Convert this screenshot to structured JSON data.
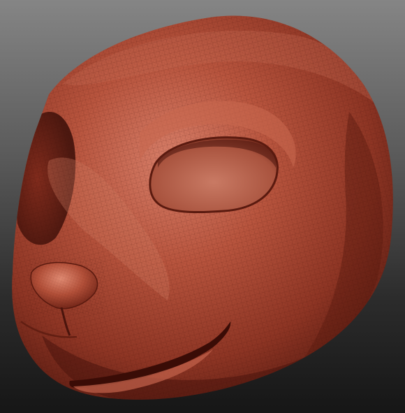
{
  "scene": {
    "subject": "rabbit-head-sculpt",
    "render_mode": "wireframe-polyframe",
    "colors": {
      "background_top": "#858585",
      "background_bottom": "#161616",
      "clay_highlight": "#d9806a",
      "clay_base": "#a8442f",
      "clay_shadow": "#4a140c",
      "wire": "#3a0c06"
    }
  },
  "labels": {}
}
